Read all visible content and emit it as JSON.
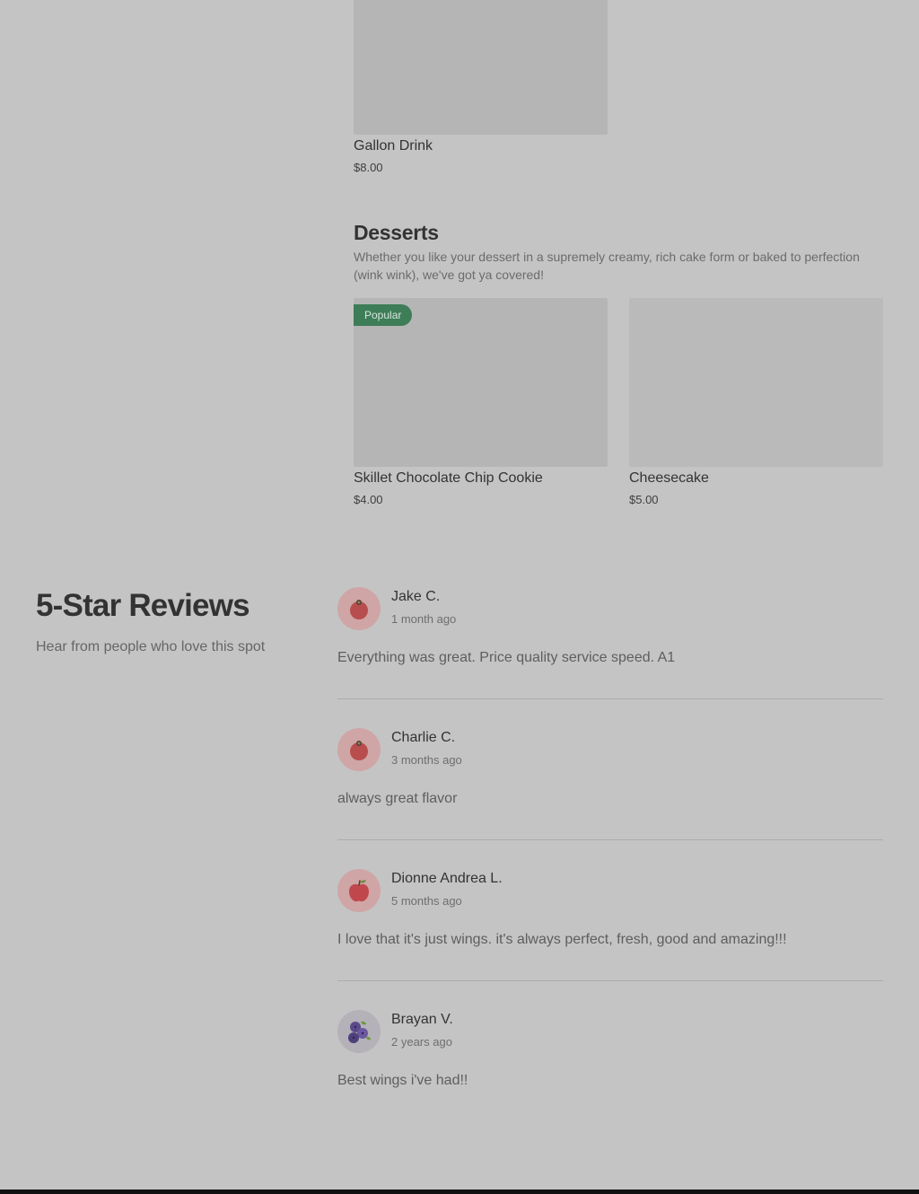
{
  "menu": {
    "drinks_items": [
      {
        "name": "Gallon Drink",
        "price": "$8.00"
      }
    ],
    "desserts": {
      "title": "Desserts",
      "description": "Whether you like your dessert in a supremely creamy, rich cake form or baked to perfection (wink wink), we've got ya covered!",
      "items": [
        {
          "name": "Skillet Chocolate Chip Cookie",
          "price": "$4.00",
          "badge": "Popular"
        },
        {
          "name": "Cheesecake",
          "price": "$5.00"
        }
      ]
    }
  },
  "reviews": {
    "title": "5-Star Reviews",
    "subtitle": "Hear from people who love this spot",
    "items": [
      {
        "name": "Jake C.",
        "time": "1 month ago",
        "text": "Everything was great. Price quality service speed. A1",
        "avatar_icon": "tomato-icon"
      },
      {
        "name": "Charlie C.",
        "time": "3 months ago",
        "text": "always great flavor",
        "avatar_icon": "tomato-icon"
      },
      {
        "name": "Dionne Andrea L.",
        "time": "5 months ago",
        "text": "I love that it's just wings. it's always perfect, fresh, good and amazing!!!",
        "avatar_icon": "apple-icon"
      },
      {
        "name": "Brayan V.",
        "time": "2 years ago",
        "text": "Best wings i've had!!",
        "avatar_icon": "blueberry-icon"
      }
    ]
  },
  "colors": {
    "background": "#c4c4c4",
    "badge": "#3d7d57",
    "placeholder_image": "#b5b5b5"
  }
}
